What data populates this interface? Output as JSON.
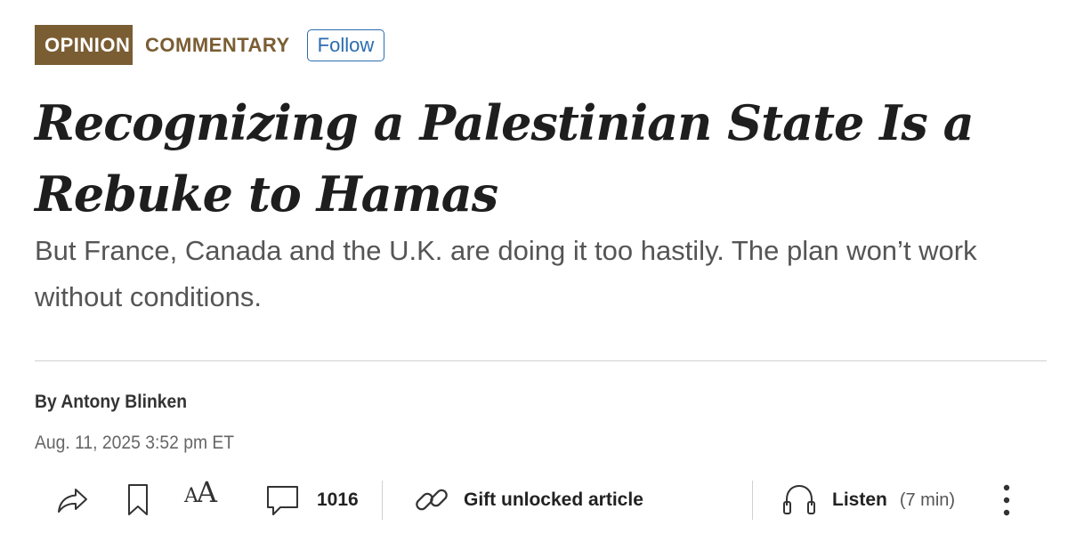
{
  "section": {
    "badge": "OPINION",
    "category": "COMMENTARY",
    "follow_label": "Follow"
  },
  "article": {
    "headline": "Recognizing a Palestinian State Is a Rebuke to Hamas",
    "dek": "But France, Canada and the U.K. are doing it too hastily. The plan won’t work without conditions.",
    "byline": "By Antony Blinken",
    "date": "Aug. 11, 2025 3:52 pm ET"
  },
  "toolbar": {
    "text_size_small": "A",
    "text_size_large": "A",
    "comment_count": "1016",
    "gift_label": "Gift unlocked article",
    "listen_label": "Listen",
    "listen_duration": "(7 min)"
  },
  "colors": {
    "badge_bg": "#7a5d33",
    "category": "#7a5d33",
    "follow": "#2b6cb0",
    "headline": "#1e1e1e",
    "dek": "#555555",
    "rule": "#cfcfcf"
  },
  "icons": {
    "share": "share-icon",
    "bookmark": "bookmark-icon",
    "text_size": "text-size-icon",
    "comment": "comment-icon",
    "gift": "link-icon",
    "listen": "headphones-icon",
    "more": "more-vertical-icon"
  }
}
